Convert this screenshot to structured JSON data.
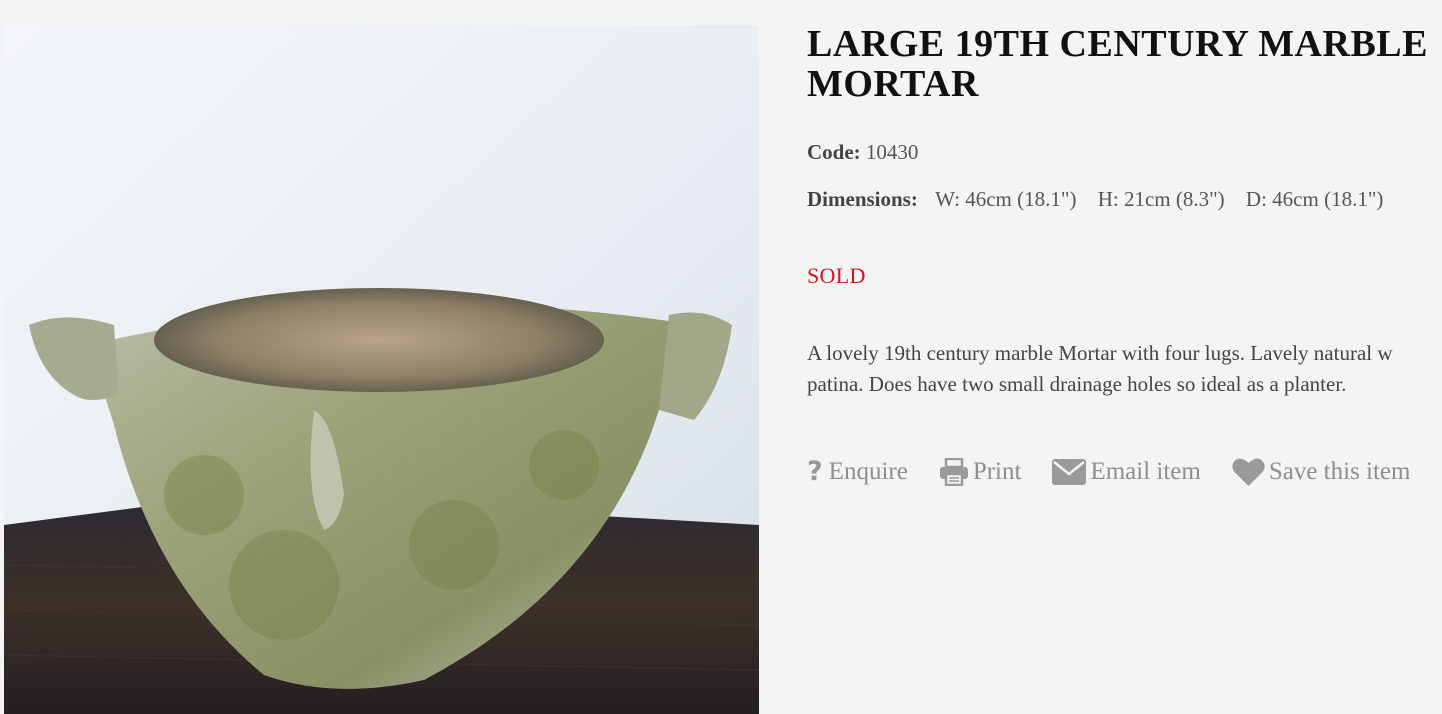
{
  "product": {
    "title_line1": "LARGE 19TH CENTURY MARBLE",
    "title_line2": "MORTAR",
    "code_label": "Code:",
    "code_value": "10430",
    "dimensions_label": "Dimensions:",
    "dim_w": "W: 46cm (18.1\")",
    "dim_h": "H: 21cm (8.3\")",
    "dim_d": "D: 46cm (18.1\")",
    "status": "SOLD",
    "description_line1": "A lovely 19th century marble Mortar with four lugs. Lavely natural w",
    "description_line2": "patina. Does have two small drainage holes so ideal as a planter."
  },
  "actions": {
    "enquire": "Enquire",
    "print": "Print",
    "email": "Email item",
    "save": "Save this item"
  },
  "colors": {
    "sold": "#d4141b",
    "action_icon": "#9a9a9a",
    "background": "#f4f4f4"
  },
  "icons": {
    "enquire": "question-mark-icon",
    "print": "printer-icon",
    "email": "envelope-icon",
    "save": "heart-icon"
  }
}
